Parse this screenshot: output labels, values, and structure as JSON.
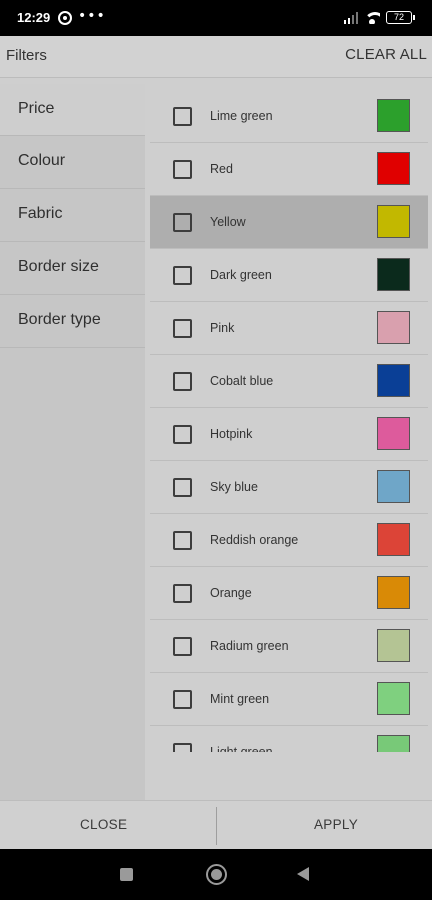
{
  "status_bar": {
    "time": "12:29",
    "battery": "72"
  },
  "header": {
    "title": "Filters",
    "clear_all": "CLEAR ALL"
  },
  "categories": [
    {
      "label": "Price",
      "active": true
    },
    {
      "label": "Colour",
      "active": false
    },
    {
      "label": "Fabric",
      "active": false
    },
    {
      "label": "Border size",
      "active": false
    },
    {
      "label": "Border type",
      "active": false
    }
  ],
  "colours": [
    {
      "name": "Lime green",
      "hex": "#2ca02c",
      "checked": false
    },
    {
      "name": "Red",
      "hex": "#e00000",
      "checked": false
    },
    {
      "name": "Yellow",
      "hex": "#c2b800",
      "checked": false,
      "highlighted": true
    },
    {
      "name": "Dark green",
      "hex": "#0b2a1c",
      "checked": false
    },
    {
      "name": "Pink",
      "hex": "#d9a0ae",
      "checked": false
    },
    {
      "name": "Cobalt blue",
      "hex": "#0a3f96",
      "checked": false
    },
    {
      "name": "Hotpink",
      "hex": "#dd5b9c",
      "checked": false
    },
    {
      "name": "Sky blue",
      "hex": "#6fa6c8",
      "checked": false
    },
    {
      "name": "Reddish orange",
      "hex": "#dc4437",
      "checked": false
    },
    {
      "name": "Orange",
      "hex": "#d98a06",
      "checked": false
    },
    {
      "name": "Radium green",
      "hex": "#b4c494",
      "checked": false
    },
    {
      "name": "Mint green",
      "hex": "#7fd07f",
      "checked": false
    },
    {
      "name": "Light green",
      "hex": "#78c978",
      "checked": false
    }
  ],
  "footer": {
    "close": "CLOSE",
    "apply": "APPLY"
  }
}
